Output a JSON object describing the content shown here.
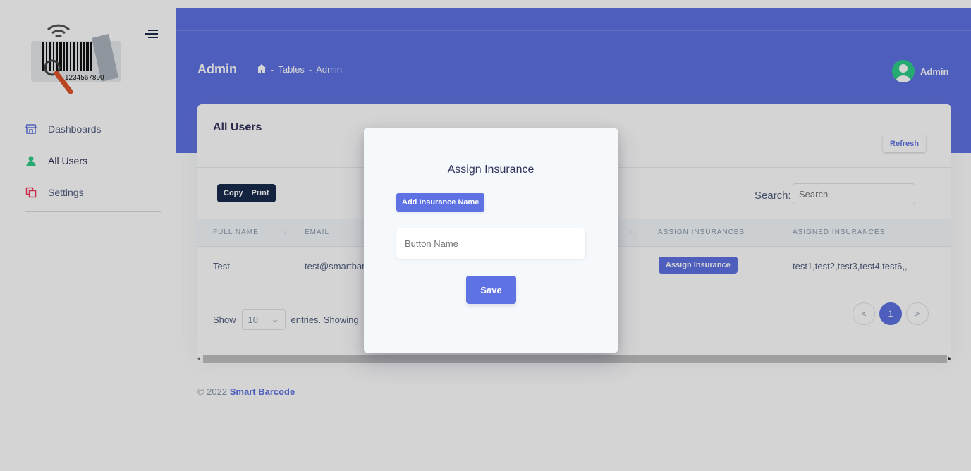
{
  "app": {
    "logo_text": "1234567890",
    "colors": {
      "primary": "#5e72e4",
      "dark": "#172b4d",
      "success": "#2dce89",
      "danger": "#f5365c"
    }
  },
  "sidebar": {
    "items": [
      {
        "label": "Dashboards",
        "icon": "shop-icon"
      },
      {
        "label": "All Users",
        "icon": "user-icon"
      },
      {
        "label": "Settings",
        "icon": "settings-icon"
      }
    ]
  },
  "header": {
    "title": "Admin",
    "breadcrumb": [
      "Tables",
      "Admin"
    ],
    "user_name": "Admin"
  },
  "card": {
    "title": "All Users",
    "refresh_label": "Refresh",
    "copy_label": "Copy",
    "print_label": "Print",
    "search_label": "Search:",
    "search_placeholder": "Search",
    "columns": [
      "FULL NAME",
      "EMAIL",
      "ASSIGN INSURANCES",
      "ASIGNED INSURANCES"
    ],
    "rows": [
      {
        "full_name": "Test",
        "email": "test@smartbar",
        "assign_label": "Assign Insurance",
        "assigned": "test1,test2,test3,test4,test6,,"
      }
    ],
    "show_label": "Show",
    "page_size": "10",
    "entries_label": "entries. Showing",
    "pages": [
      "<",
      "1",
      ">"
    ]
  },
  "footer": {
    "copyright": "© 2022",
    "brand": "Smart Barcode"
  },
  "modal": {
    "title": "Assign Insurance",
    "add_button_label": "Add Insurance Name",
    "input_placeholder": "Button Name",
    "save_label": "Save"
  }
}
